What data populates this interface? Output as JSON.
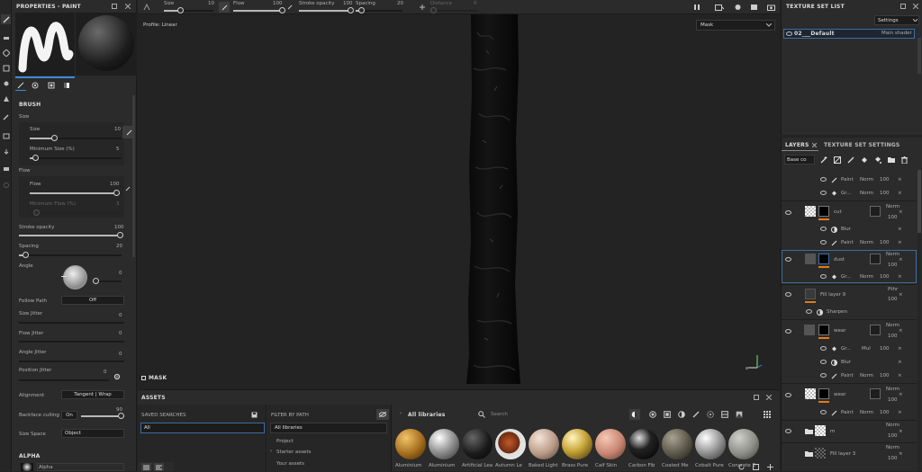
{
  "properties": {
    "title": "PROPERTIES - PAINT",
    "section_brush": "BRUSH",
    "size_group": "Size",
    "size_label": "Size",
    "size_value": "10",
    "min_size_label": "Minimum Size (%)",
    "min_size_value": "5",
    "flow_group": "Flow",
    "flow_label": "Flow",
    "flow_value": "100",
    "min_flow_label": "Minimum Flow (%)",
    "min_flow_value": "3",
    "stroke_opacity_label": "Stroke opacity",
    "stroke_opacity_value": "100",
    "spacing_label": "Spacing",
    "spacing_value": "20",
    "angle_label": "Angle",
    "angle_value": "0",
    "follow_path_label": "Follow Path",
    "follow_path_value": "Off",
    "size_jitter_label": "Size Jitter",
    "size_jitter_value": "0",
    "flow_jitter_label": "Flow Jitter",
    "flow_jitter_value": "0",
    "angle_jitter_label": "Angle Jitter",
    "angle_jitter_value": "0",
    "position_jitter_label": "Position Jitter",
    "position_jitter_value": "0",
    "alignment_label": "Alignment",
    "alignment_value": "Tangent | Wrap",
    "backface_label": "Backface culling",
    "backface_toggle": "On",
    "backface_value": "90",
    "size_space_label": "Size Space",
    "size_space_value": "Object",
    "alpha_section": "ALPHA",
    "alpha_name": "Alpha"
  },
  "toolbar": {
    "size_label": "Size",
    "size_value": "10",
    "flow_label": "Flow",
    "flow_value": "100",
    "stroke_label": "Stroke opacity",
    "stroke_value": "100",
    "spacing_label": "Spacing",
    "spacing_value": "20",
    "distance_label": "Distance",
    "distance_value": "0"
  },
  "viewport": {
    "profile": "Profile: Linear",
    "mask_select": "Mask",
    "mask_label": "MASK"
  },
  "assets": {
    "title": "ASSETS",
    "saved_searches": "SAVED SEARCHES",
    "saved_all": "All",
    "filter_by_path": "FILTER BY PATH",
    "paths": [
      "All libraries",
      "Project",
      "Starter assets",
      "Your assets"
    ],
    "library_title": "All libraries",
    "search_placeholder": "Search",
    "materials": [
      "Aluminium",
      "Aluminium",
      "Artificial Lea",
      "Autumn Le",
      "Baked Light",
      "Brass Pure",
      "Calf Skin",
      "Carbon Fib",
      "Coated Me",
      "Cobalt Pure",
      "Concrete B"
    ]
  },
  "texture_set": {
    "title": "TEXTURE SET LIST",
    "settings": "Settings",
    "item_name": "02___Default",
    "item_shader": "Main shader"
  },
  "layers": {
    "tab_layers": "LAYERS",
    "tab_tss": "TEXTURE SET SETTINGS",
    "channel": "Base co",
    "rows": [
      {
        "name": "Paint",
        "blend": "Norm",
        "opacity": "100"
      },
      {
        "name": "Gr...",
        "blend": "Norm",
        "opacity": "100"
      },
      {
        "name": "cut",
        "blend": "Norm",
        "opacity": "100"
      },
      {
        "name": "Blur"
      },
      {
        "name": "Paint",
        "blend": "Norm",
        "opacity": "100"
      },
      {
        "name": "dust",
        "blend": "Norm",
        "opacity": "100"
      },
      {
        "name": "Gr...",
        "blend": "Norm",
        "opacity": "100"
      },
      {
        "name": "Fill layer 9",
        "blend": "Pthr",
        "opacity": "100"
      },
      {
        "name": "Sharpen"
      },
      {
        "name": "wear",
        "blend": "Norm",
        "opacity": "100"
      },
      {
        "name": "Gr...",
        "blend": "Mul",
        "opacity": "100"
      },
      {
        "name": "Blur"
      },
      {
        "name": "Paint",
        "blend": "Norm",
        "opacity": "100"
      },
      {
        "name": "wear",
        "blend": "Norm",
        "opacity": "100"
      },
      {
        "name": "Paint",
        "blend": "Norm",
        "opacity": "100"
      },
      {
        "name": "m",
        "blend": "Norm",
        "opacity": "100"
      },
      {
        "name": "Fill layer 3",
        "blend": "Norm",
        "opacity": "100"
      }
    ]
  },
  "colors": {
    "accent": "#e07b1e",
    "panel": "#2b2b2b",
    "viewport": "#232323",
    "selection": "#3b6ea5"
  }
}
